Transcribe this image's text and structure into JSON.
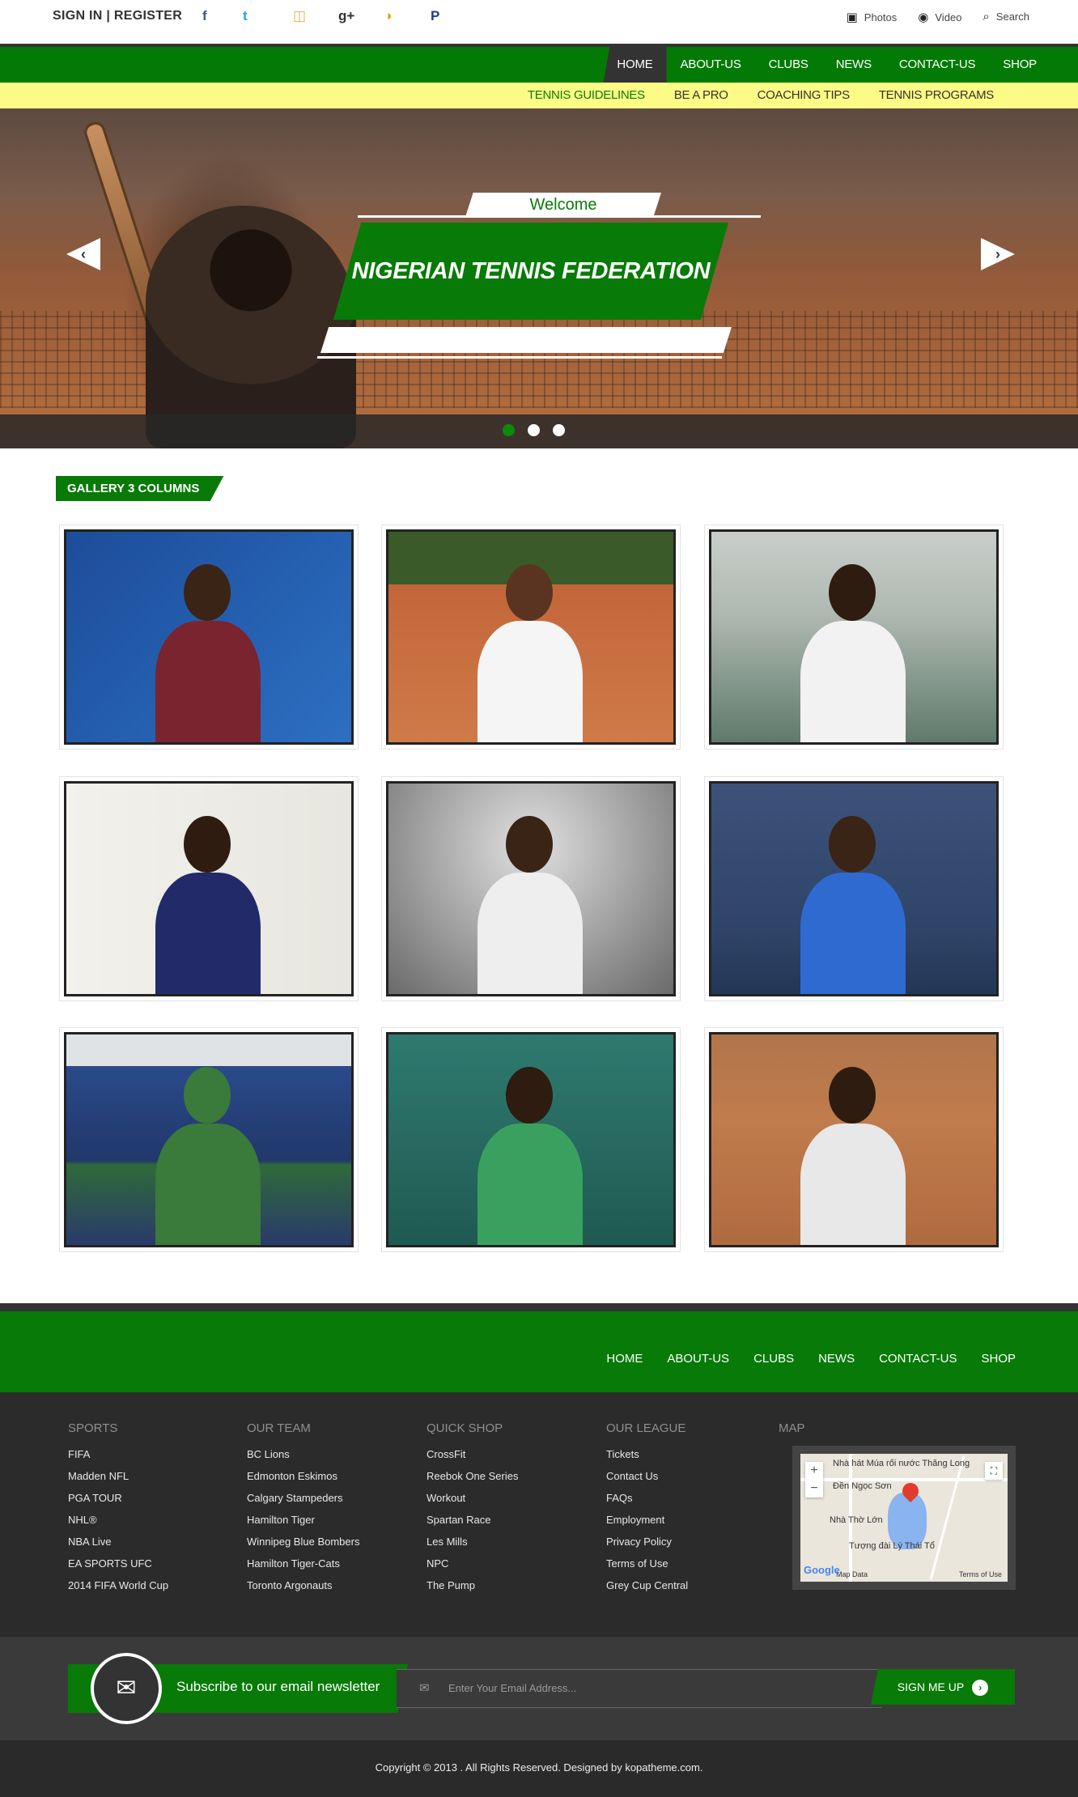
{
  "topbar": {
    "signin": "SIGN IN | REGISTER",
    "social": [
      {
        "icon": "facebook-icon",
        "glyph": "f",
        "color": "#3b5998"
      },
      {
        "icon": "twitter-icon",
        "glyph": "t",
        "color": "#1da1f2"
      },
      {
        "icon": "instagram-icon",
        "glyph": "◫",
        "color": "#e0b040"
      },
      {
        "icon": "google-plus-icon",
        "glyph": "g+",
        "color": "#333333"
      },
      {
        "icon": "rss-icon",
        "glyph": "◗",
        "color": "#e0a000"
      },
      {
        "icon": "pinterest-icon",
        "glyph": "P",
        "color": "#1f3d8f"
      }
    ],
    "links": {
      "photos": "Photos",
      "video": "Video",
      "search": "Search"
    }
  },
  "nav": {
    "items": [
      "HOME",
      "ABOUT-US",
      "CLUBS",
      "NEWS",
      "CONTACT-US",
      "SHOP"
    ],
    "active": "HOME"
  },
  "subnav": {
    "items": [
      "TENNIS GUIDELINES",
      "BE A PRO",
      "COACHING TIPS",
      "TENNIS PROGRAMS"
    ],
    "active": "TENNIS GUIDELINES"
  },
  "hero": {
    "welcome": "Welcome",
    "title": "NIGERIAN TENNIS FEDERATION",
    "slides": 3,
    "active_slide": 1
  },
  "gallery": {
    "title": "GALLERY 3 COLUMNS"
  },
  "footer_nav": {
    "items": [
      "HOME",
      "ABOUT-US",
      "CLUBS",
      "NEWS",
      "CONTACT-US",
      "SHOP"
    ]
  },
  "footer": {
    "columns": [
      {
        "title": "SPORTS",
        "items": [
          "FIFA",
          "Madden NFL",
          "PGA TOUR",
          "NHL®",
          "NBA Live",
          "EA SPORTS UFC",
          "2014 FIFA World Cup"
        ]
      },
      {
        "title": "OUR TEAM",
        "items": [
          "BC Lions",
          "Edmonton Eskimos",
          "Calgary Stampeders",
          "Hamilton Tiger",
          "Winnipeg Blue Bombers",
          "Hamilton Tiger-Cats",
          "Toronto Argonauts"
        ]
      },
      {
        "title": "QUICK SHOP",
        "items": [
          "CrossFit",
          "Reebok One Series",
          "Workout",
          "Spartan Race",
          "Les Mills",
          "NPC",
          "The Pump"
        ]
      },
      {
        "title": "OUR LEAGUE",
        "items": [
          "Tickets",
          "Contact Us",
          "FAQs",
          "Employment",
          "Privacy Policy",
          "Terms of Use",
          "Grey Cup Central"
        ]
      }
    ],
    "map": {
      "title": "MAP",
      "labels": [
        "Nhà hát Múa rối nước Thăng Long",
        "Đền Ngọc Sơn",
        "Nhà Thờ Lớn",
        "Tượng đài Lý Thái Tổ",
        "Map Data",
        "Terms of Use",
        "Google"
      ]
    }
  },
  "newsletter": {
    "label": "Subscribe to our email newsletter",
    "placeholder": "Enter Your Email Address...",
    "button": "SIGN ME UP"
  },
  "copyright": "Copyright © 2013 . All Rights Reserved. Designed by kopatheme.com.",
  "colors": {
    "green": "#087a07",
    "dark": "#2b2b2b",
    "yellow": "#fbfb86"
  }
}
